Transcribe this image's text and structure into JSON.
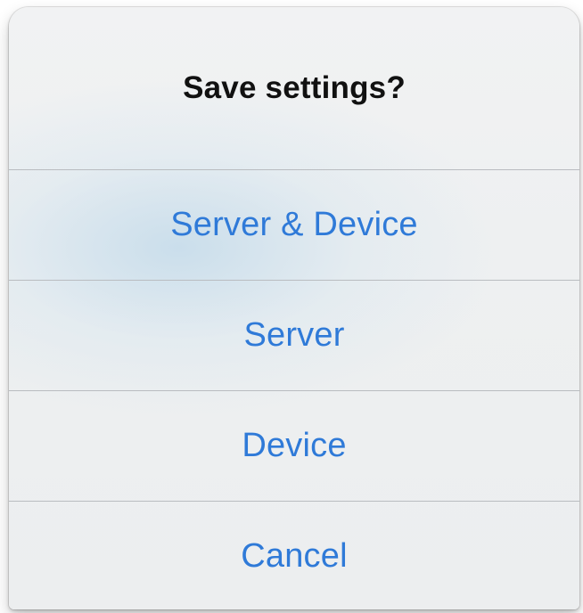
{
  "dialog": {
    "title": "Save settings?",
    "options": [
      {
        "label": "Server & Device"
      },
      {
        "label": "Server"
      },
      {
        "label": "Device"
      },
      {
        "label": "Cancel"
      }
    ]
  },
  "colors": {
    "action_text": "#2f7ad8",
    "title_text": "#111111",
    "separator": "#b9bcc0",
    "sheet_background": "#eef0f1"
  }
}
